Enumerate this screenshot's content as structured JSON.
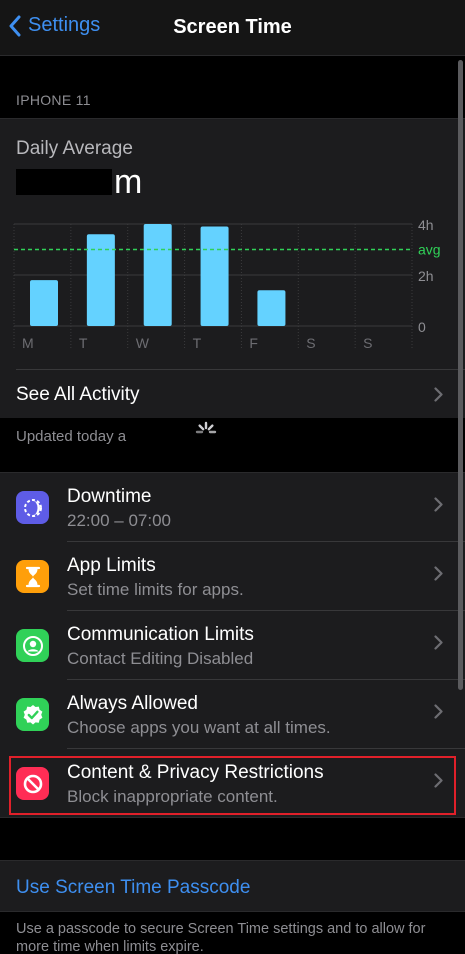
{
  "nav": {
    "back_label": "Settings",
    "title": "Screen Time"
  },
  "device_header": "IPHONE 11",
  "summary": {
    "label": "Daily Average",
    "value_suffix": "m"
  },
  "see_all": "See All Activity",
  "updated": "Updated today a",
  "list": [
    {
      "title": "Downtime",
      "subtitle": "22:00 – 07:00",
      "icon": "downtime-icon",
      "color": "#5e5ce6"
    },
    {
      "title": "App Limits",
      "subtitle": "Set time limits for apps.",
      "icon": "hourglass-icon",
      "color": "#ff9f0a"
    },
    {
      "title": "Communication Limits",
      "subtitle": "Contact Editing Disabled",
      "icon": "contact-icon",
      "color": "#30d158"
    },
    {
      "title": "Always Allowed",
      "subtitle": "Choose apps you want at all times.",
      "icon": "checkmark-badge-icon",
      "color": "#30d158"
    },
    {
      "title": "Content & Privacy Restrictions",
      "subtitle": "Block inappropriate content.",
      "icon": "restriction-icon",
      "color": "#ff2d55"
    }
  ],
  "passcode_link": "Use Screen Time Passcode",
  "footer": "Use a passcode to secure Screen Time settings and to allow for more time when limits expire.",
  "chart_data": {
    "type": "bar",
    "categories": [
      "M",
      "T",
      "W",
      "T",
      "F",
      "S",
      "S"
    ],
    "values": [
      1.8,
      3.6,
      4.0,
      3.9,
      1.4,
      0,
      0
    ],
    "y_ticks": [
      "4h",
      "2h",
      "0"
    ],
    "y_tick_values": [
      4,
      2,
      0
    ],
    "ylim": [
      0,
      4
    ],
    "average": 3.0,
    "average_label": "avg",
    "bar_color": "#64d2ff",
    "average_color": "#30d158",
    "grid": true
  }
}
